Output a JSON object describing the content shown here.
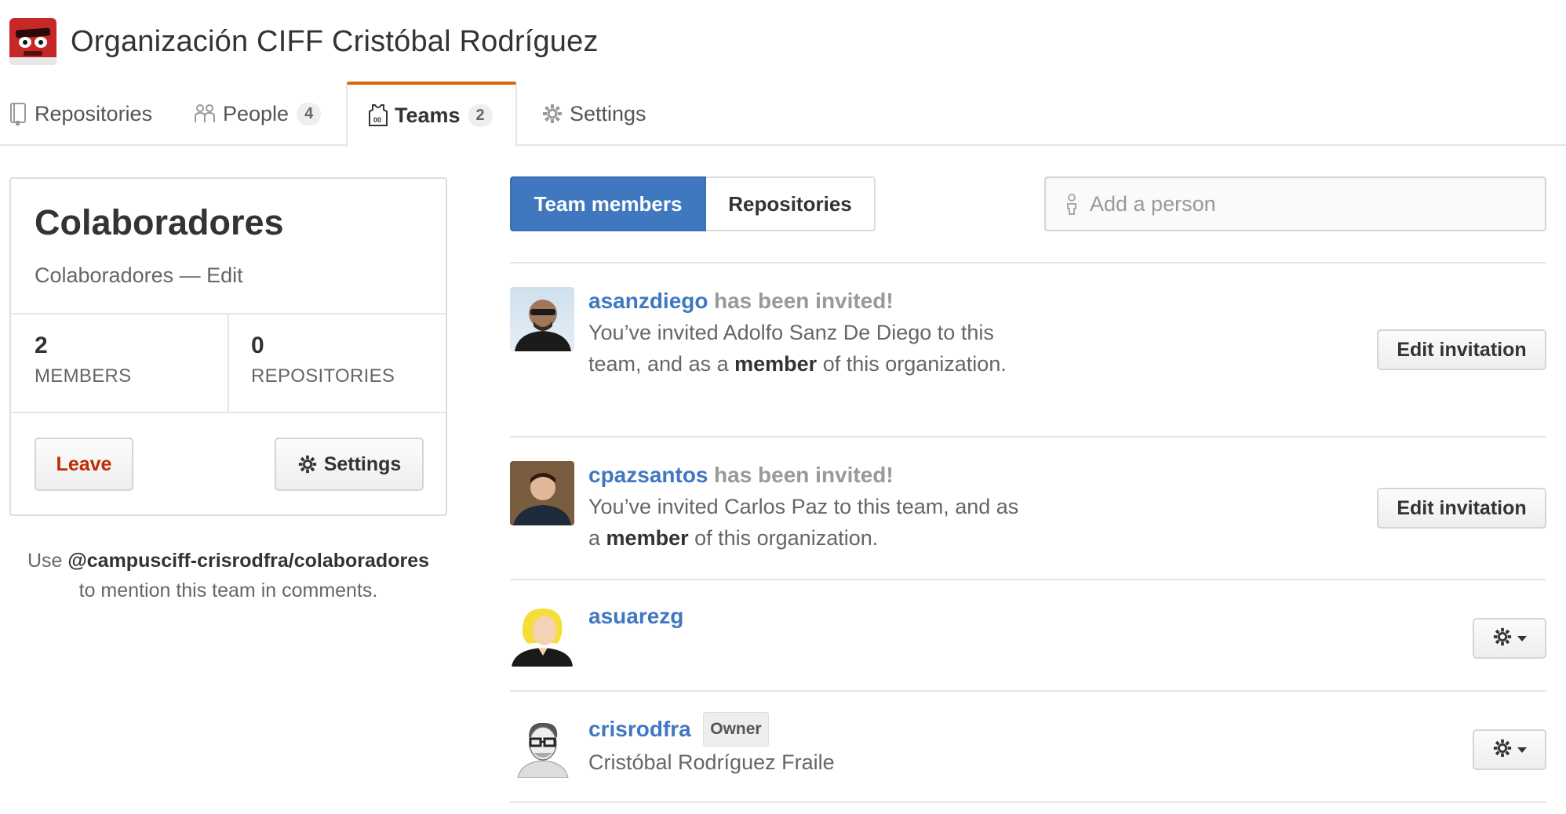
{
  "org": {
    "name": "Organización CIFF Cristóbal Rodríguez",
    "avatar_icon": "inside-out-anger-avatar"
  },
  "tabs": [
    {
      "label": "Repositories",
      "icon": "repo-icon",
      "count": null,
      "selected": false
    },
    {
      "label": "People",
      "icon": "people-icon",
      "count": "4",
      "selected": false
    },
    {
      "label": "Teams",
      "icon": "jersey-icon",
      "count": "2",
      "selected": true
    },
    {
      "label": "Settings",
      "icon": "gear-icon",
      "count": null,
      "selected": false
    }
  ],
  "team": {
    "name": "Colaboradores",
    "description": "Colaboradores",
    "dash": "—",
    "edit_label": "Edit",
    "members_count": "2",
    "members_label": "MEMBERS",
    "repos_count": "0",
    "repos_label": "REPOSITORIES",
    "leave_label": "Leave",
    "settings_label": "Settings"
  },
  "mention": {
    "prefix": "Use",
    "handle": "@campusciff-crisrodfra/colaboradores",
    "suffix": "to mention this team in comments."
  },
  "segmented": {
    "members_label": "Team members",
    "repos_label": "Repositories",
    "active": "members"
  },
  "add_person": {
    "placeholder": "Add a person",
    "value": ""
  },
  "members": [
    {
      "login": "asanzdiego",
      "status": "has been invited!",
      "msg_pre": "You’ve invited Adolfo Sanz De Diego to this team, and as a",
      "msg_role": "member",
      "msg_post": "of this organization.",
      "action": "Edit invitation"
    },
    {
      "login": "cpazsantos",
      "status": "has been invited!",
      "msg_pre": "You’ve invited Carlos Paz to this team, and as a",
      "msg_role": "member",
      "msg_post": "of this organization.",
      "action": "Edit invitation"
    },
    {
      "login": "asuarezg"
    },
    {
      "login": "crisrodfra",
      "badge": "Owner",
      "full_name": "Cristóbal Rodríguez Fraile"
    }
  ],
  "colors": {
    "link": "#4078c0",
    "tab_accent": "#d26911",
    "leave": "#bd2c00",
    "active_segment": "#4078c0"
  }
}
